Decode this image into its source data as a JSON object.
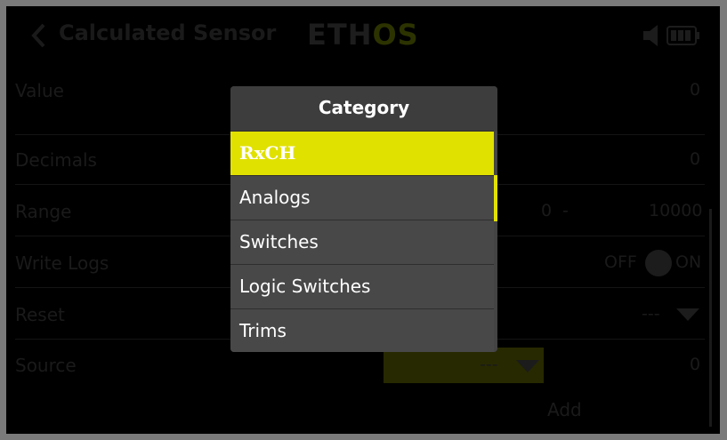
{
  "header": {
    "title": "Calculated Sensor",
    "logo_main": "ETH",
    "logo_accent": "OS"
  },
  "form": {
    "value": {
      "label": "Value",
      "value": "0"
    },
    "decimals": {
      "label": "Decimals",
      "value": "0"
    },
    "range": {
      "label": "Range",
      "min": "0",
      "separator": "-",
      "max": "10000"
    },
    "write_logs": {
      "label": "Write Logs",
      "off": "OFF",
      "on": "ON"
    },
    "reset": {
      "label": "Reset",
      "value": "---"
    },
    "source": {
      "label": "Source",
      "selector": "---",
      "value": "0"
    },
    "add_label": "Add"
  },
  "modal": {
    "title": "Category",
    "items": [
      {
        "label": "RxCH",
        "selected": true
      },
      {
        "label": "Analogs",
        "selected": false
      },
      {
        "label": "Switches",
        "selected": false
      },
      {
        "label": "Logic Switches",
        "selected": false
      },
      {
        "label": "Trims",
        "selected": false
      }
    ]
  },
  "colors": {
    "accent": "#e1e100",
    "modal_bg": "#444444",
    "screen_bg": "#000000"
  },
  "icons": [
    "back-arrow-icon",
    "speaker-icon",
    "battery-icon",
    "dropdown-arrow-icon",
    "toggle-knob-icon"
  ]
}
